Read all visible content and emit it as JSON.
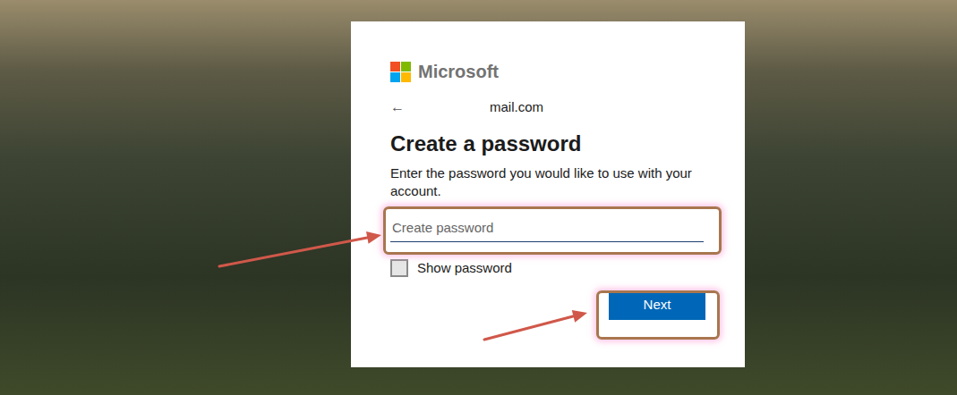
{
  "logo": {
    "text": "Microsoft"
  },
  "identity": {
    "back": "←",
    "email": "mail.com"
  },
  "title": "Create a password",
  "description": "Enter the password you would like to use with your account.",
  "password": {
    "placeholder": "Create password"
  },
  "show_password": {
    "label": "Show password",
    "checked": false
  },
  "buttons": [
    "Next"
  ]
}
